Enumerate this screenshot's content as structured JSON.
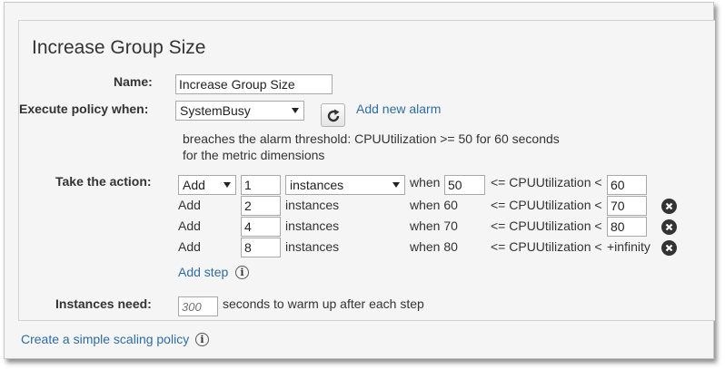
{
  "title": "Increase Group Size",
  "name_label": "Name:",
  "name_value": "Increase Group Size",
  "execute_label": "Execute policy when:",
  "alarm_selected": "SystemBusy",
  "refresh_icon": "refresh-icon",
  "add_alarm_link": "Add new alarm",
  "alarm_description_line1": "breaches the alarm threshold: CPUUtilization >= 50 for 60 seconds",
  "alarm_description_line2": "for the metric dimensions",
  "take_action_label": "Take the action:",
  "steps": [
    {
      "action": "Add",
      "value": "1",
      "unit": "instances",
      "when": "when",
      "lower": "50",
      "cmp": "<= CPUUtilization <",
      "upper": "60"
    },
    {
      "action": "Add",
      "value": "2",
      "unit": "instances",
      "when": "when 60",
      "cmp": "<= CPUUtilization <",
      "upper": "70"
    },
    {
      "action": "Add",
      "value": "4",
      "unit": "instances",
      "when": "when 70",
      "cmp": "<= CPUUtilization <",
      "upper": "80"
    },
    {
      "action": "Add",
      "value": "8",
      "unit": "instances",
      "when": "when 80",
      "cmp": "<= CPUUtilization <",
      "upper": "+infinity"
    }
  ],
  "add_step_link": "Add step",
  "instances_need_label": "Instances need:",
  "warmup_placeholder": "300",
  "warmup_suffix": "seconds to warm up after each step",
  "simple_policy_link": "Create a simple scaling policy",
  "info_glyph": "i",
  "colors": {
    "link": "#2e6da4",
    "background": "#f5f5f5",
    "text": "#333333"
  }
}
